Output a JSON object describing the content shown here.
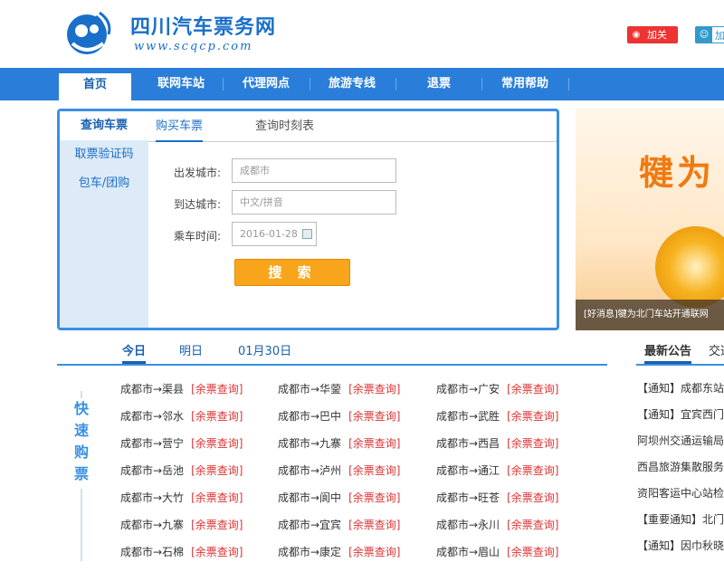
{
  "header": {
    "site_name": "四川汽车票务网",
    "site_url": "www.scqcp.com",
    "follow_weibo": "加关注",
    "follow_weibo_icon": "weibo-icon",
    "add_qq": "加",
    "add_qq_icon": "qq-icon"
  },
  "nav": {
    "items": [
      {
        "label": "首页",
        "active": true
      },
      {
        "label": "联网车站"
      },
      {
        "label": "代理网点"
      },
      {
        "label": "旅游专线"
      },
      {
        "label": "退票"
      },
      {
        "label": "常用帮助"
      }
    ]
  },
  "search": {
    "side_tabs": [
      "查询车票",
      "取票验证码",
      "包车/团购"
    ],
    "sub_tabs": [
      "购买车票",
      "查询时刻表"
    ],
    "from_label": "出发城市:",
    "from_value": "成都市",
    "to_label": "到达城市:",
    "to_placeholder": "中文/拼音",
    "date_label": "乘车时间:",
    "date_value": "2016-01-28",
    "submit_label": "搜 索"
  },
  "banner": {
    "title": "犍为",
    "caption": "[好消息]犍为北门车站开通联网"
  },
  "quick": {
    "day_tabs": [
      "今日",
      "明日",
      "01月30日"
    ],
    "label": "快速购票",
    "link_label": "[余票查询]",
    "routes": [
      [
        "成都市→渠县",
        "成都市→华蓥",
        "成都市→广安"
      ],
      [
        "成都市→邻水",
        "成都市→巴中",
        "成都市→武胜"
      ],
      [
        "成都市→营宁",
        "成都市→九寨",
        "成都市→西昌"
      ],
      [
        "成都市→岳池",
        "成都市→泸州",
        "成都市→通江"
      ],
      [
        "成都市→大竹",
        "成都市→阆中",
        "成都市→旺苍"
      ],
      [
        "成都市→九寨",
        "成都市→宜宾",
        "成都市→永川"
      ],
      [
        "成都市→石棉",
        "成都市→康定",
        "成都市→眉山"
      ]
    ]
  },
  "notices": {
    "tabs": [
      "最新公告",
      "交通"
    ],
    "items": [
      "【通知】成都东站",
      "【通知】宜宾西门",
      "阿坝州交通运输局",
      "西昌旅游集散服务",
      "资阳客运中心站检",
      "【重要通知】北门",
      "【通知】因巾秋晓"
    ]
  }
}
